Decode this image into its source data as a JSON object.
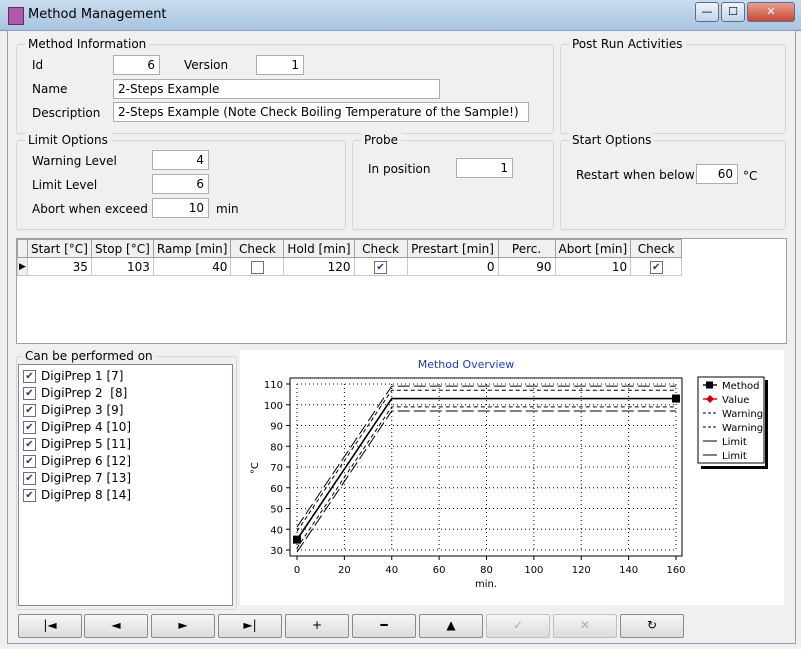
{
  "window": {
    "title": "Method Management",
    "minimize": "—",
    "maximize": "☐",
    "close": "✕"
  },
  "method_info": {
    "legend": "Method Information",
    "id_label": "Id",
    "id_value": "6",
    "version_label": "Version",
    "version_value": "1",
    "name_label": "Name",
    "name_value": "2-Steps Example",
    "desc_label": "Description",
    "desc_value": "2-Steps Example (Note Check Boiling Temperature of the Sample!)"
  },
  "post_run": {
    "legend": "Post Run Activities"
  },
  "limit_options": {
    "legend": "Limit Options",
    "warning_label": "Warning Level",
    "warning_value": "4",
    "limit_label": "Limit Level",
    "limit_value": "6",
    "abort_label": "Abort when exceed",
    "abort_value": "10",
    "abort_unit": "min"
  },
  "probe": {
    "legend": "Probe",
    "position_label": "In position",
    "position_value": "1"
  },
  "start_options": {
    "legend": "Start Options",
    "restart_label": "Restart when below",
    "restart_value": "60",
    "restart_unit": "°C"
  },
  "steps": {
    "columns": [
      "Start [°C]",
      "Stop [°C]",
      "Ramp [min]",
      "Check",
      "Hold [min]",
      "Check",
      "Prestart [min]",
      "Perc.",
      "Abort [min]",
      "Check"
    ],
    "rows": [
      {
        "start": "35",
        "stop": "103",
        "ramp": "40",
        "ramp_check": false,
        "hold": "120",
        "hold_check": true,
        "prestart": "0",
        "perc": "90",
        "abort": "10",
        "abort_check": true
      }
    ]
  },
  "performed_on": {
    "legend": "Can be performed on",
    "items": [
      {
        "label": "DigiPrep 1 [7]",
        "checked": true
      },
      {
        "label": "DigiPrep 2  [8]",
        "checked": true
      },
      {
        "label": "DigiPrep 3 [9]",
        "checked": true
      },
      {
        "label": "DigiPrep 4 [10]",
        "checked": true
      },
      {
        "label": "DigiPrep 5 [11]",
        "checked": true
      },
      {
        "label": "DigiPrep 6 [12]",
        "checked": true
      },
      {
        "label": "DigiPrep 7 [13]",
        "checked": true
      },
      {
        "label": "DigiPrep 8 [14]",
        "checked": true
      }
    ]
  },
  "chart_data": {
    "type": "line",
    "title": "Method Overview",
    "xlabel": "min.",
    "ylabel": "°C",
    "xlim": [
      0,
      160
    ],
    "ylim": [
      30,
      110
    ],
    "xticks": [
      0,
      20,
      40,
      60,
      80,
      100,
      120,
      140,
      160
    ],
    "yticks": [
      30,
      40,
      50,
      60,
      70,
      80,
      90,
      100,
      110
    ],
    "grid": true,
    "legend_position": "right",
    "series": [
      {
        "name": "Method",
        "style": "solid",
        "color": "#000000",
        "x": [
          0,
          40,
          160
        ],
        "y": [
          35,
          103,
          103
        ],
        "markers": [
          0,
          2
        ]
      },
      {
        "name": "Value",
        "style": "solid",
        "color": "#cc0000",
        "x": [],
        "y": []
      },
      {
        "name": "Warning",
        "style": "dashed-small",
        "color": "#000000",
        "x": [
          0,
          40,
          160
        ],
        "y": [
          39,
          107,
          107
        ]
      },
      {
        "name": "Warning",
        "style": "dashed-small",
        "color": "#000000",
        "x": [
          0,
          40,
          160
        ],
        "y": [
          31,
          99,
          99
        ]
      },
      {
        "name": "Limit",
        "style": "dashed-long",
        "color": "#000000",
        "x": [
          0,
          40,
          160
        ],
        "y": [
          41,
          109,
          109
        ]
      },
      {
        "name": "Limit",
        "style": "dashed-long",
        "color": "#000000",
        "x": [
          0,
          40,
          160
        ],
        "y": [
          29,
          97,
          97
        ]
      }
    ]
  },
  "toolbar": {
    "first": "|◄",
    "prev": "◄",
    "next": "►",
    "last": "►|",
    "add": "+",
    "remove": "━",
    "up": "▲",
    "confirm": "✓",
    "cancel": "✕",
    "refresh": "↻"
  }
}
